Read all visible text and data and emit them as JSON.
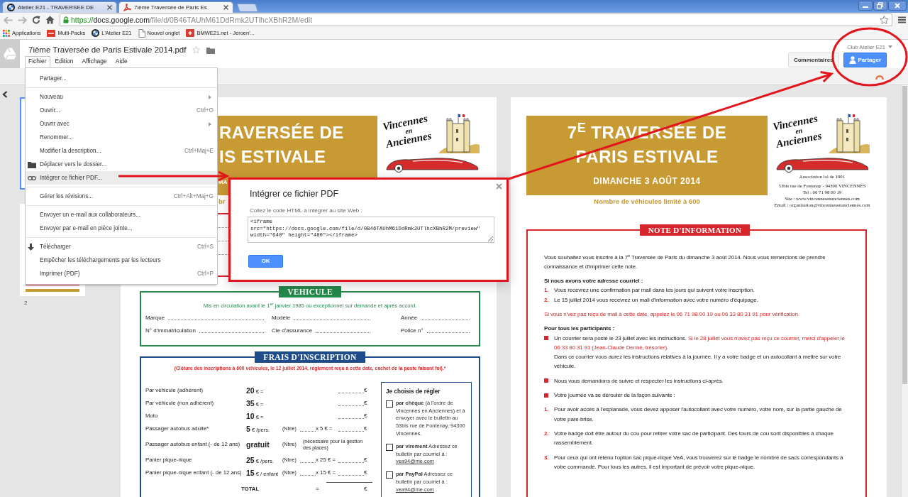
{
  "browser": {
    "tabs": [
      {
        "title": "Atelier E21 - TRAVERSEE DE",
        "kind": "roundel",
        "selected": false
      },
      {
        "title": "7ième Traversée de Paris Es",
        "kind": "pdf",
        "selected": true
      }
    ],
    "url": {
      "scheme": "https://",
      "host": "docs.google.com",
      "path": "/file/d/0B46TAUhM61DdRmk2UTlhcXBhR2M/edit"
    },
    "bookmarks": [
      {
        "label": "Applications",
        "kind": "apps"
      },
      {
        "label": "Multi-Packs",
        "kind": "tile"
      },
      {
        "label": "L'Atelier E21",
        "kind": "roundel"
      },
      {
        "label": "Nouvel onglet",
        "kind": "page"
      },
      {
        "label": "BMWE21.net - Jeroen'...",
        "kind": "gplus"
      }
    ]
  },
  "app": {
    "title": "7ième Traversée de Paris Estivale 2014.pdf",
    "starred": false,
    "menubar": [
      {
        "label": "Fichier",
        "selected": true
      },
      {
        "label": "Édition",
        "selected": false
      },
      {
        "label": "Affichage",
        "selected": false
      },
      {
        "label": "Aide",
        "selected": false
      }
    ],
    "account": "Club Atelier E21",
    "buttons": [
      {
        "label": "Commentaires",
        "kind": "comments"
      },
      {
        "label": "Partager",
        "kind": "share"
      }
    ]
  },
  "file_menu": {
    "groups": [
      [
        {
          "label": "Partager...",
          "kind": "plain",
          "submenu": false,
          "selected": false
        }
      ],
      [
        {
          "label": "Nouveau",
          "kind": "plain",
          "submenu": true,
          "selected": false
        },
        {
          "label": "Ouvrir...",
          "shortcut": "Ctrl+O",
          "kind": "plain",
          "submenu": false,
          "selected": false
        },
        {
          "label": "Ouvrir avec",
          "kind": "plain",
          "submenu": true,
          "selected": false
        },
        {
          "label": "Renommer...",
          "kind": "plain",
          "submenu": false,
          "selected": false
        },
        {
          "label": "Modifier la description...",
          "shortcut": "Ctrl+Maj+E",
          "kind": "plain",
          "submenu": false,
          "selected": false
        },
        {
          "label": "Déplacer vers le dossier...",
          "kind": "move",
          "submenu": false,
          "selected": false
        },
        {
          "label": "Intégrer ce fichier PDF...",
          "kind": "embed",
          "submenu": false,
          "selected": true
        }
      ],
      [
        {
          "label": "Gérer les révisions...",
          "shortcut": "Ctrl+Alt+Maj+G",
          "kind": "plain",
          "submenu": false,
          "selected": false
        }
      ],
      [
        {
          "label": "Envoyer un e-mail aux collaborateurs...",
          "kind": "plain",
          "submenu": false,
          "selected": false
        },
        {
          "label": "Envoyer par e-mail en pièce jointe...",
          "kind": "plain",
          "submenu": false,
          "selected": false
        }
      ],
      [
        {
          "label": "Télécharger",
          "shortcut": "Ctrl+S",
          "kind": "download",
          "submenu": false,
          "selected": false
        },
        {
          "label": "Empêcher les téléchargements par les lecteurs",
          "kind": "plain",
          "submenu": false,
          "selected": false
        },
        {
          "label": "Imprimer (PDF)",
          "shortcut": "Ctrl+P",
          "kind": "plain",
          "submenu": false,
          "selected": false
        }
      ]
    ]
  },
  "dialog": {
    "title": "Intégrer ce fichier PDF",
    "label": "Collez le code HTML à intégrer au site Web :",
    "value": "<iframe src=\"https://docs.google.com/file/d/0B46TAUhM61DdRmk2UTlhcXBhR2M/preview\" width=\"640\" height=\"480\"></iframe>",
    "ok": "OK"
  },
  "viewer": {
    "thumbnails": [
      {
        "selected": true
      },
      {
        "selected": false,
        "label": "2"
      }
    ],
    "form_page": {
      "banner_lines": [
        "RAVERSÉE DE",
        "IS ESTIVALE",
        "MA"
      ],
      "subtitle": "br",
      "logo_lines": [
        "Vincennes",
        "en",
        "Anciennes"
      ],
      "vehicle": {
        "heading": "VEHICULE",
        "note": "Mis en circulation avant le 1$^{er}$ janvier 1985 ou exceptionnel sur demande et après accord.",
        "fields": [
          {
            "label": "Marque"
          },
          {
            "label": "Modèle"
          },
          {
            "label": "Année"
          },
          {
            "label": "N° d'immatriculation"
          },
          {
            "label": "Cie d'assurance"
          },
          {
            "label": "Police n°"
          }
        ]
      },
      "fees": {
        "heading": "FRAIS D'INSCRIPTION",
        "note": "(Clôture des inscriptions à 600 véhicules, le 12 juillet 2014, règlement reçu à cette date, cachet de la poste faisant foi).*",
        "rows": [
          {
            "kind": "flat",
            "label": "Par véhicule (adhérent)",
            "amount": "20",
            "unit": "€ =",
            "currency": "€"
          },
          {
            "kind": "flat",
            "label": "Par véhicule (non adhérent)",
            "amount": "35",
            "unit": "€ =",
            "currency": "€"
          },
          {
            "kind": "flat",
            "label": "Moto",
            "amount": "10",
            "unit": "€ =",
            "currency": "€"
          },
          {
            "kind": "count",
            "label": "Passager autobus adulte*",
            "amount": "5",
            "unit": "€ /pers.",
            "count_label": "(Nbre)",
            "multiplier": "x 5 € =",
            "currency": "€"
          },
          {
            "kind": "info",
            "label": "Passager autobus enfant (- de 12 ans)",
            "amount": "gratuit",
            "count_label": "(Nbre)",
            "info": "(nécessaire pour la gestion des places)"
          },
          {
            "kind": "count",
            "label": "Panier pique-nique",
            "amount": "25",
            "unit": "€ /pers.",
            "count_label": "(Nbre)",
            "multiplier": "x 25 € =",
            "currency": "€"
          },
          {
            "kind": "count",
            "label": "Panier pique-nique enfant (- de 12 ans)",
            "amount": "15",
            "unit": "€ / enfant",
            "count_label": "(Nbre)",
            "multiplier": "x 15 € =",
            "currency": "€"
          }
        ],
        "total": {
          "label": "TOTAL",
          "equals": "=",
          "currency": "€"
        },
        "payment": {
          "heading": "Je choisis de régler",
          "options": [
            {
              "title": "par chèque",
              "text": "(à l'ordre de Vincennes en Anciennes) et à envoyer avec le bulletin au 53bis rue de Fontenay, 94300 Vincennes.",
              "checked": false
            },
            {
              "title": "par virement",
              "text": "Adressez ce bulletin par courriel à :",
              "email": "vea94@me.com",
              "checked": false
            },
            {
              "title": "par PayPal",
              "text": "Adressez ce bulletin par courriel à :",
              "email": "vea94@me.com",
              "checked": false
            }
          ]
        }
      }
    },
    "note_page": {
      "banner_lines": [
        "7$^{E}$ TRAVERSÉE DE",
        "PARIS ESTIVALE",
        "DIMANCHE 3 AOÛT 2014"
      ],
      "subtitle": "Nombre de véhicules limité à 600",
      "logo_lines": [
        "Vincennes",
        "en",
        "Anciennes"
      ],
      "address": [
        "Association loi de 1901",
        "53bis rue de Fontenay - 94300 VINCENNES",
        "Tel : 06 71 98 00 19",
        "Site : www.vincennesenanciennes.com",
        "Email : organisation@vincennesenanciennes.com"
      ],
      "note": {
        "heading": "NOTE D'INFORMATION",
        "blocks": [
          {
            "kind": "paragraph",
            "segments": [
              {
                "text": "Vous souhaitez vous inscrire à la 7$^{e}$ Traversée de Paris du dimanche 3 août 2014. Nous vous remercions de prendre connaissance et d'imprimer cette note.",
                "kind": "plain"
              }
            ]
          },
          {
            "kind": "heading",
            "text": "Si nous avons votre adresse courriel :"
          },
          {
            "kind": "list",
            "items": [
              {
                "kind": "numbered",
                "marker": "1.",
                "paragraphs": [
                  [
                    {
                      "text": "Vous recevrez une confirmation par mail dans les jours qui suivent votre inscription.",
                      "kind": "plain"
                    }
                  ]
                ]
              },
              {
                "kind": "numbered",
                "marker": "2.",
                "paragraphs": [
                  [
                    {
                      "text": "Le 15 juillet 2014 vous recevrez un mail d'information avec votre numéro d'équipage.",
                      "kind": "plain"
                    }
                  ]
                ]
              }
            ]
          },
          {
            "kind": "paragraph",
            "segments": [
              {
                "text": "Si vous n'vez pas reçu de mail à cette date, appelez le 06 71 98 00 19 ou 06 33 80 31 91 pour vérification.",
                "kind": "alert"
              }
            ]
          },
          {
            "kind": "heading",
            "text": "Pour tous les participants :"
          },
          {
            "kind": "list",
            "items": [
              {
                "kind": "bullet",
                "paragraphs": [
                  [
                    {
                      "text": "Un courrier sera posté le 23 juillet avec les instructions.",
                      "kind": "plain"
                    },
                    {
                      "text": "Si le 28 juillet vous n'avez pas reçu ce courrier, merci d'appeler le 06 33 80 31 91 (Jean-Claude Denné, trésorier).",
                      "kind": "alert"
                    }
                  ],
                  [
                    {
                      "text": "Dans ce courrier vous aurez les instructions relatives à la journée. Il y a votre badge et un autocollant à mettre sur votre véhicule.",
                      "kind": "plain"
                    }
                  ]
                ]
              }
            ]
          },
          {
            "kind": "list",
            "items": [
              {
                "kind": "bullet",
                "paragraphs": [
                  [
                    {
                      "text": "Nous vous demandons de suivre et respecter les instructions ci-après.",
                      "kind": "plain"
                    }
                  ]
                ]
              }
            ]
          },
          {
            "kind": "list",
            "items": [
              {
                "kind": "bullet",
                "paragraphs": [
                  [
                    {
                      "text": "Votre journée va se dérouler de la façon suivante :",
                      "kind": "plain"
                    }
                  ]
                ]
              }
            ]
          },
          {
            "kind": "list",
            "items": [
              {
                "kind": "numbered",
                "marker": "1.",
                "paragraphs": [
                  [
                    {
                      "text": "Pour avoir accès à l'esplanade, vous devez apposer l'autocollant avec votre numéro, votre nom, sur la partie gauche de votre pare-brise.",
                      "kind": "plain"
                    }
                  ]
                ]
              }
            ]
          },
          {
            "kind": "list",
            "items": [
              {
                "kind": "numbered",
                "marker": "2.",
                "paragraphs": [
                  [
                    {
                      "text": "Votre badge doit être autour du cou pour retirer votre sac de participant. Des tours de cou sont disponibles à chaque rassemblement.",
                      "kind": "plain"
                    }
                  ]
                ]
              }
            ]
          },
          {
            "kind": "list",
            "items": [
              {
                "kind": "numbered",
                "marker": "3.",
                "paragraphs": [
                  [
                    {
                      "text": "Pour ceux qui ont retenu l'option sac pique-nique VeA, vous trouverez sur le badge le nombre de sacs correspondants à votre commande. Pour tous les autres, il est important de prévoir votre pique-nique.",
                      "kind": "plain"
                    }
                  ]
                ]
              }
            ]
          }
        ]
      }
    }
  }
}
